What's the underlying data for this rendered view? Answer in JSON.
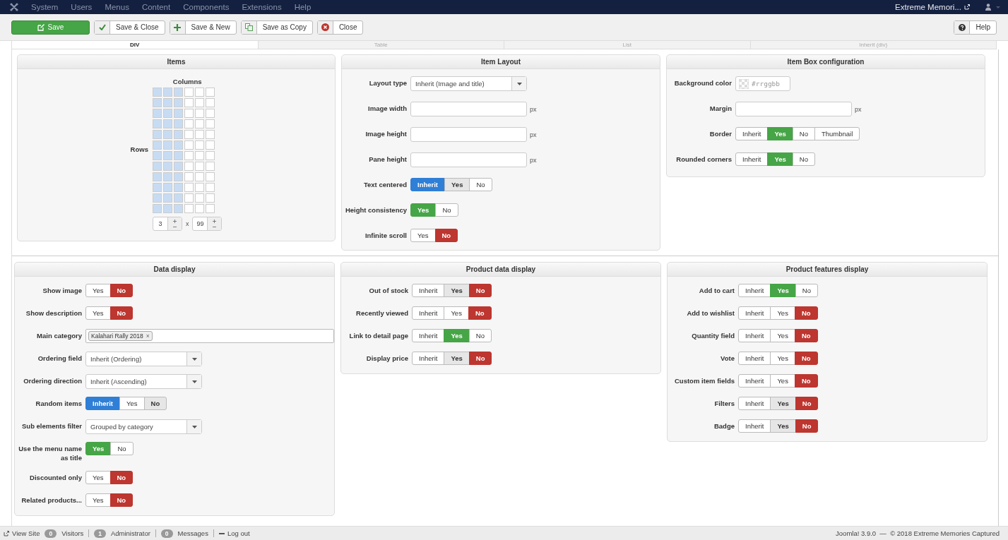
{
  "topbar": {
    "menus": [
      "System",
      "Users",
      "Menus",
      "Content",
      "Components",
      "Extensions",
      "Help"
    ],
    "site": "Extreme Memori..."
  },
  "toolbar": {
    "buttons": [
      {
        "label": "Save",
        "kind": "primary"
      },
      {
        "label": "Save & Close",
        "kind": "check"
      },
      {
        "label": "Save & New",
        "kind": "plus"
      },
      {
        "label": "Save as Copy",
        "kind": "copy"
      },
      {
        "label": "Close",
        "kind": "close"
      }
    ],
    "help": "Help"
  },
  "tabs": [
    {
      "label": "DIV",
      "selected": true
    },
    {
      "label": "Table",
      "selected": false
    },
    {
      "label": "List",
      "selected": false
    },
    {
      "label": "Inherit (div)",
      "selected": false
    }
  ],
  "panels_top": [
    {
      "title": "Items",
      "kind": "grid",
      "columns_label": "Columns",
      "rows_label": "Rows",
      "columns": "3",
      "rows": "99",
      "times": "x"
    },
    {
      "title": "Item Layout",
      "kind": "form",
      "fields": [
        {
          "label": "Layout type",
          "kind": "select",
          "value": "Inherit (Image and title)"
        },
        {
          "label": "Image width",
          "kind": "text",
          "unit": "px"
        },
        {
          "label": "Image height",
          "kind": "text",
          "unit": "px"
        },
        {
          "label": "Pane height",
          "kind": "text",
          "unit": "px"
        },
        {
          "label": "Text centered",
          "kind": "toggle",
          "options": [
            {
              "label": "Inherit",
              "color": "#2f7fd6",
              "selected": true,
              "default": false
            },
            {
              "label": "Yes",
              "selected": false,
              "default": true
            },
            {
              "label": "No",
              "selected": false,
              "default": false
            }
          ]
        },
        {
          "label": "Height consistency",
          "kind": "toggle",
          "options": [
            {
              "label": "Yes",
              "color": "#46a546",
              "selected": true,
              "default": false
            },
            {
              "label": "No",
              "selected": false,
              "default": false
            }
          ]
        },
        {
          "label": "Infinite scroll",
          "kind": "toggle",
          "options": [
            {
              "label": "Yes",
              "selected": false,
              "default": false
            },
            {
              "label": "No",
              "color": "#bd362f",
              "selected": true,
              "default": false
            }
          ]
        }
      ]
    },
    {
      "title": "Item Box configuration",
      "kind": "form",
      "fields": [
        {
          "label": "Background color",
          "kind": "color",
          "placeholder": "#rrggbb"
        },
        {
          "label": "Margin",
          "kind": "text",
          "unit": "px"
        },
        {
          "label": "Border",
          "kind": "toggle",
          "options": [
            {
              "label": "Inherit",
              "selected": false,
              "default": false
            },
            {
              "label": "Yes",
              "color": "#46a546",
              "selected": true,
              "default": false
            },
            {
              "label": "No",
              "selected": false,
              "default": false
            },
            {
              "label": "Thumbnail",
              "selected": false,
              "default": false
            }
          ]
        },
        {
          "label": "Rounded corners",
          "kind": "toggle",
          "options": [
            {
              "label": "Inherit",
              "selected": false,
              "default": false
            },
            {
              "label": "Yes",
              "color": "#46a546",
              "selected": true,
              "default": false
            },
            {
              "label": "No",
              "selected": false,
              "default": false
            }
          ]
        }
      ]
    }
  ],
  "panels_bottom": [
    {
      "title": "Data display",
      "kind": "form",
      "fields": [
        {
          "label": "Show image",
          "kind": "toggle",
          "options": [
            {
              "label": "Yes",
              "selected": false,
              "default": false
            },
            {
              "label": "No",
              "color": "#bd362f",
              "selected": true,
              "default": false
            }
          ]
        },
        {
          "label": "Show description",
          "kind": "toggle",
          "options": [
            {
              "label": "Yes",
              "selected": false,
              "default": false
            },
            {
              "label": "No",
              "color": "#bd362f",
              "selected": true,
              "default": false
            }
          ]
        },
        {
          "label": "Main category",
          "kind": "tags",
          "tags": [
            "Kalahari Rally 2018"
          ],
          "remove": "×"
        },
        {
          "label": "Ordering field",
          "kind": "select",
          "value": "Inherit (Ordering)"
        },
        {
          "label": "Ordering direction",
          "kind": "select",
          "value": "Inherit (Ascending)"
        },
        {
          "label": "Random items",
          "kind": "toggle",
          "options": [
            {
              "label": "Inherit",
              "color": "#2f7fd6",
              "selected": true,
              "default": false
            },
            {
              "label": "Yes",
              "selected": false,
              "default": false
            },
            {
              "label": "No",
              "selected": false,
              "default": true
            }
          ]
        },
        {
          "label": "Sub elements filter",
          "kind": "select",
          "value": "Grouped by category"
        },
        {
          "label": "Use the menu name as title",
          "kind": "toggle",
          "options": [
            {
              "label": "Yes",
              "color": "#46a546",
              "selected": true,
              "default": false
            },
            {
              "label": "No",
              "selected": false,
              "default": false
            }
          ]
        },
        {
          "label": "Discounted only",
          "kind": "toggle",
          "options": [
            {
              "label": "Yes",
              "selected": false,
              "default": false
            },
            {
              "label": "No",
              "color": "#bd362f",
              "selected": true,
              "default": false
            }
          ]
        },
        {
          "label": "Related products...",
          "kind": "toggle",
          "options": [
            {
              "label": "Yes",
              "selected": false,
              "default": false
            },
            {
              "label": "No",
              "color": "#bd362f",
              "selected": true,
              "default": false
            }
          ]
        }
      ]
    },
    {
      "title": "Product data display",
      "kind": "form",
      "fields": [
        {
          "label": "Out of stock",
          "kind": "toggle",
          "options": [
            {
              "label": "Inherit",
              "selected": false,
              "default": false
            },
            {
              "label": "Yes",
              "selected": false,
              "default": true
            },
            {
              "label": "No",
              "color": "#bd362f",
              "selected": true,
              "default": false
            }
          ]
        },
        {
          "label": "Recently viewed",
          "kind": "toggle",
          "options": [
            {
              "label": "Inherit",
              "selected": false,
              "default": false
            },
            {
              "label": "Yes",
              "selected": false,
              "default": false
            },
            {
              "label": "No",
              "color": "#bd362f",
              "selected": true,
              "default": false
            }
          ]
        },
        {
          "label": "Link to detail page",
          "kind": "toggle",
          "options": [
            {
              "label": "Inherit",
              "selected": false,
              "default": false
            },
            {
              "label": "Yes",
              "color": "#46a546",
              "selected": true,
              "default": false
            },
            {
              "label": "No",
              "selected": false,
              "default": false
            }
          ]
        },
        {
          "label": "Display price",
          "kind": "toggle",
          "options": [
            {
              "label": "Inherit",
              "selected": false,
              "default": false
            },
            {
              "label": "Yes",
              "selected": false,
              "default": true
            },
            {
              "label": "No",
              "color": "#bd362f",
              "selected": true,
              "default": false
            }
          ]
        }
      ]
    },
    {
      "title": "Product features display",
      "kind": "form",
      "fields": [
        {
          "label": "Add to cart",
          "kind": "toggle",
          "options": [
            {
              "label": "Inherit",
              "selected": false,
              "default": false
            },
            {
              "label": "Yes",
              "color": "#46a546",
              "selected": true,
              "default": false
            },
            {
              "label": "No",
              "selected": false,
              "default": false
            }
          ]
        },
        {
          "label": "Add to wishlist",
          "kind": "toggle",
          "options": [
            {
              "label": "Inherit",
              "selected": false,
              "default": false
            },
            {
              "label": "Yes",
              "selected": false,
              "default": false
            },
            {
              "label": "No",
              "color": "#bd362f",
              "selected": true,
              "default": false
            }
          ]
        },
        {
          "label": "Quantity field",
          "kind": "toggle",
          "options": [
            {
              "label": "Inherit",
              "selected": false,
              "default": false
            },
            {
              "label": "Yes",
              "selected": false,
              "default": false
            },
            {
              "label": "No",
              "color": "#bd362f",
              "selected": true,
              "default": false
            }
          ]
        },
        {
          "label": "Vote",
          "kind": "toggle",
          "options": [
            {
              "label": "Inherit",
              "selected": false,
              "default": false
            },
            {
              "label": "Yes",
              "selected": false,
              "default": false
            },
            {
              "label": "No",
              "color": "#bd362f",
              "selected": true,
              "default": false
            }
          ]
        },
        {
          "label": "Custom item fields",
          "kind": "toggle",
          "options": [
            {
              "label": "Inherit",
              "selected": false,
              "default": false
            },
            {
              "label": "Yes",
              "selected": false,
              "default": false
            },
            {
              "label": "No",
              "color": "#bd362f",
              "selected": true,
              "default": false
            }
          ]
        },
        {
          "label": "Filters",
          "kind": "toggle",
          "options": [
            {
              "label": "Inherit",
              "selected": false,
              "default": false
            },
            {
              "label": "Yes",
              "selected": false,
              "default": true
            },
            {
              "label": "No",
              "color": "#bd362f",
              "selected": true,
              "default": false
            }
          ]
        },
        {
          "label": "Badge",
          "kind": "toggle",
          "options": [
            {
              "label": "Inherit",
              "selected": false,
              "default": false
            },
            {
              "label": "Yes",
              "selected": false,
              "default": true
            },
            {
              "label": "No",
              "color": "#bd362f",
              "selected": true,
              "default": false
            }
          ]
        }
      ]
    }
  ],
  "status_bar": {
    "view_site": "View Site",
    "counters": [
      {
        "count": "0",
        "label": "Visitors"
      },
      {
        "count": "1",
        "label": "Administrator"
      },
      {
        "count": "0",
        "label": "Messages"
      }
    ],
    "logout": "Log out",
    "footer": "Joomla! 3.9.0  —  © 2018 Extreme Memories Captured"
  }
}
